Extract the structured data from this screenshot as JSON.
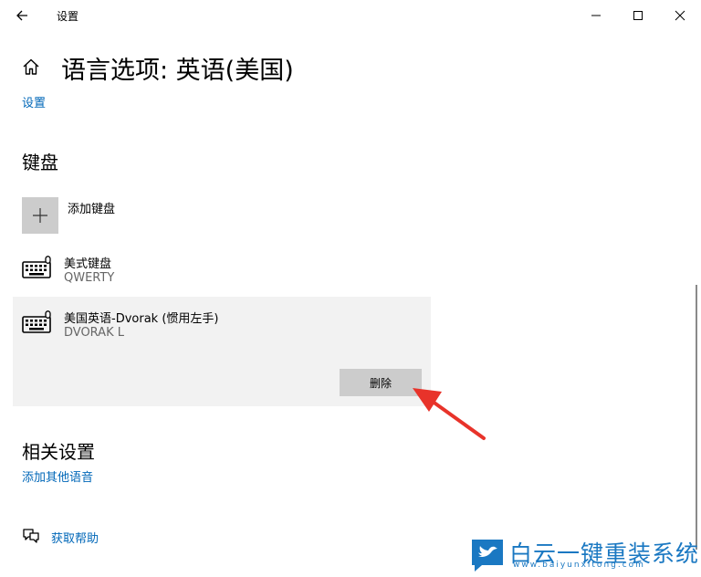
{
  "window": {
    "title": "设置"
  },
  "page": {
    "title": "语言选项: 英语(美国)",
    "breadcrumb": "设置"
  },
  "keyboard_section": {
    "title": "键盘",
    "add_label": "添加键盘",
    "items": [
      {
        "name": "美式键盘",
        "layout": "QWERTY"
      },
      {
        "name": "美国英语-Dvorak (惯用左手)",
        "layout": "DVORAK L"
      }
    ],
    "remove_label": "删除"
  },
  "related": {
    "title": "相关设置",
    "link": "添加其他语音"
  },
  "help": {
    "label": "获取帮助"
  },
  "watermark": {
    "text": "白云一键重装系统",
    "url": "www.baiyunxitong.com"
  },
  "colors": {
    "accent": "#0067b8",
    "arrow": "#e8332a",
    "panel": "#f2f2f2"
  }
}
